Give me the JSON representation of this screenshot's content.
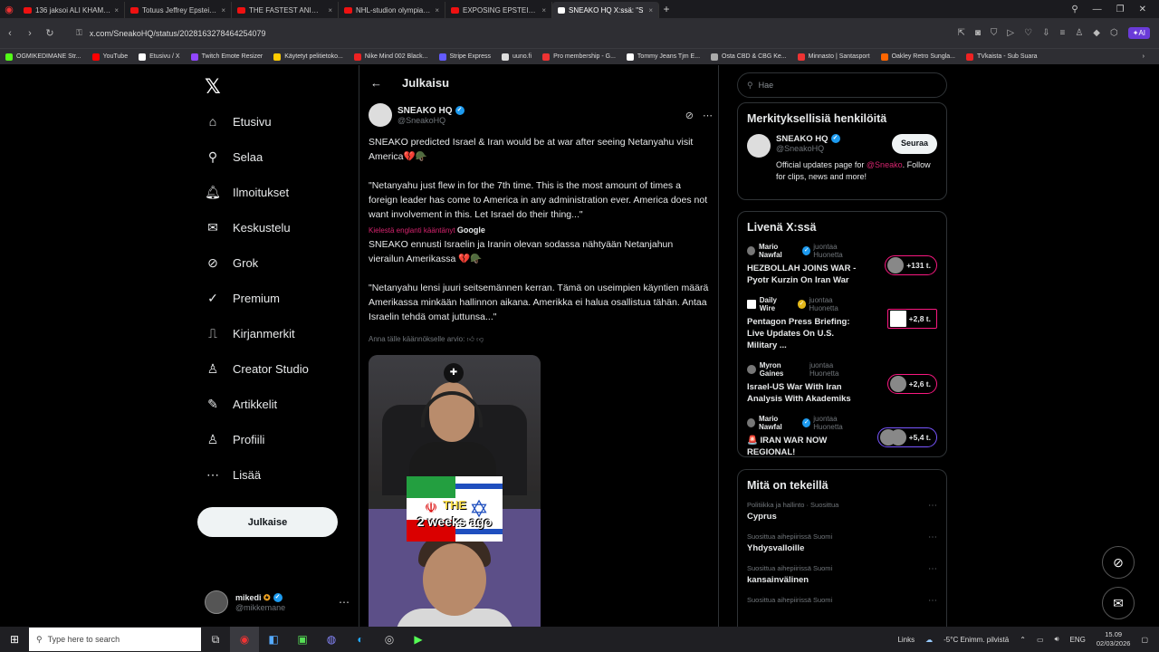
{
  "browser": {
    "tabs": [
      {
        "title": "136 jaksoi ALI KHAMENEI",
        "color": "#e11"
      },
      {
        "title": "Totuus Jeffrey Epsteinin Ki",
        "color": "#e11"
      },
      {
        "title": "THE FASTEST ANIMATRONI",
        "color": "#e11"
      },
      {
        "title": "NHL-studion olympiatuol",
        "color": "#e11"
      },
      {
        "title": "EXPOSING EPSTEIN'S ZOR",
        "color": "#e11"
      },
      {
        "title": "SNEAKO HQ X:ssä: \"S",
        "color": "#fff"
      }
    ],
    "url": "x.com/SneakoHQ/status/2028163278464254079",
    "bookmarks": [
      {
        "label": "OGMIKEDIMANE Str...",
        "color": "#53fc18"
      },
      {
        "label": "YouTube",
        "color": "#f00"
      },
      {
        "label": "Etusivu / X",
        "color": "#fff"
      },
      {
        "label": "Twitch Emote Resizer",
        "color": "#9146ff"
      },
      {
        "label": "Käytetyt pelitietoko...",
        "color": "#ffcc00"
      },
      {
        "label": "Nike Mind 002 Black...",
        "color": "#e22"
      },
      {
        "label": "Stripe Express",
        "color": "#635bff"
      },
      {
        "label": "uuno.fi",
        "color": "#ddd"
      },
      {
        "label": "Pro membership - G...",
        "color": "#e33"
      },
      {
        "label": "Tommy Jeans Tjm E...",
        "color": "#fff"
      },
      {
        "label": "Osta CBD & CBG Ke...",
        "color": "#aaa"
      },
      {
        "label": "Minnasto | Santasport",
        "color": "#e33"
      },
      {
        "label": "Oakley Retro Sungla...",
        "color": "#f60"
      },
      {
        "label": "TVkaista - Sub Suara",
        "color": "#e22"
      }
    ]
  },
  "nav": {
    "items": [
      {
        "label": "Etusivu",
        "icon": "⌂"
      },
      {
        "label": "Selaa",
        "icon": "⚲"
      },
      {
        "label": "Ilmoitukset",
        "icon": "🔔︎"
      },
      {
        "label": "Keskustelu",
        "icon": "✉"
      },
      {
        "label": "Grok",
        "icon": "⊘"
      },
      {
        "label": "Premium",
        "icon": "✓"
      },
      {
        "label": "Kirjanmerkit",
        "icon": "⎍"
      },
      {
        "label": "Creator Studio",
        "icon": "♙"
      },
      {
        "label": "Artikkelit",
        "icon": "✎"
      },
      {
        "label": "Profiili",
        "icon": "♙"
      },
      {
        "label": "Lisää",
        "icon": "⋯"
      }
    ],
    "post_button": "Julkaise",
    "me": {
      "name": "mikedi",
      "handle": "@mikkemane"
    }
  },
  "main": {
    "title": "Julkaisu",
    "author": {
      "name": "SNEAKO HQ",
      "handle": "@SneakoHQ"
    },
    "text1": "SNEAKO predicted Israel & Iran would be at war after seeing Netanyahu visit America💔🪖",
    "text2": "\"Netanyahu just flew in for the 7th time. This is the most amount of times a foreign leader has come to America in any administration ever. America does not want involvement in this. Let Israel do their thing...\"",
    "translated_by": "Kielestä englanti kääntänyt",
    "translator": "Google",
    "text3": "SNEAKO ennusti Israelin ja Iranin olevan sodassa nähtyään Netanjahun vierailun Amerikassa 💔🪖",
    "text4": "\"Netanyahu lensi juuri seitsemännen kerran. Tämä on useimpien käyntien määrä Amerikassa minkään hallinnon aikana. Amerikka ei halua osallistua tähän. Antaa Israelin tehdä omat juttunsa...\"",
    "rate": "Anna tälle käännökselle arvio:",
    "video_caption1": "THE",
    "video_caption2": "2 weeks ago"
  },
  "right": {
    "search_placeholder": "Hae",
    "relevant_title": "Merkityksellisiä henkilöitä",
    "relevant": {
      "name": "SNEAKO HQ",
      "handle": "@SneakoHQ",
      "follow": "Seuraa",
      "bio_pre": "Official updates page for",
      "bio_mention": "@Sneako",
      "bio_post": ". Follow for clips, news and more!"
    },
    "live_title": "Livenä X:ssä",
    "live": [
      {
        "host": "Mario Nawfal",
        "suffix": "juontaa Huonetta",
        "title": "HEZBOLLAH JOINS WAR - Pyotr Kurzin On Iran War",
        "count": "+131 t."
      },
      {
        "host": "Daily Wire",
        "suffix": "juontaa Huonetta",
        "title": "Pentagon Press Briefing: Live Updates On U.S. Military ...",
        "count": "+2,8 t."
      },
      {
        "host": "Myron Gaines",
        "suffix": "juontaa Huonetta",
        "title": "Israel-US War With Iran Analysis With Akademiks",
        "count": "+2,6 t."
      },
      {
        "host": "Mario Nawfal",
        "suffix": "juontaa Huonetta",
        "title": "🚨 IRAN WAR NOW REGIONAL!",
        "count": "+5,4 t."
      }
    ],
    "trends_title": "Mitä on tekeillä",
    "trends": [
      {
        "cat": "Politiikka ja hallinto · Suosittua",
        "name": "Cyprus"
      },
      {
        "cat": "Suosittua aihepiirissä Suomi",
        "name": "Yhdysvalloille"
      },
      {
        "cat": "Suosittua aihepiirissä Suomi",
        "name": "kansainvälinen"
      },
      {
        "cat": "Suosittua aihepiirissä Suomi",
        "name": ""
      }
    ]
  },
  "taskbar": {
    "search_placeholder": "Type here to search",
    "links": "Links",
    "weather": "-5°C  Enimm. pilvistä",
    "lang": "ENG",
    "time": "15.09",
    "date": "02/03/2026"
  }
}
